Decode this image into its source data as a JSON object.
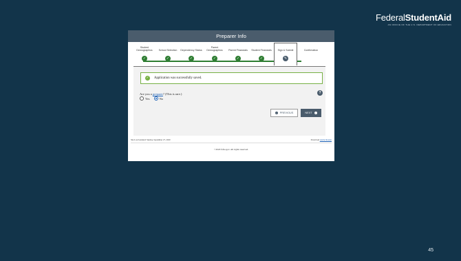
{
  "brand": {
    "name_regular": "Federal",
    "name_bold": "StudentAid",
    "subtitle": "An Office of the U.S. Department of Education"
  },
  "slide_number": "45",
  "window": {
    "title": "Preparer Info",
    "steps": [
      {
        "label": "Student Demographics",
        "status": "complete"
      },
      {
        "label": "School Selection",
        "status": "complete"
      },
      {
        "label": "Dependency Status",
        "status": "complete"
      },
      {
        "label": "Parent Demographics",
        "status": "complete"
      },
      {
        "label": "Parent Financials",
        "status": "complete"
      },
      {
        "label": "Student Financials",
        "status": "complete"
      },
      {
        "label": "Sign & Submit",
        "status": "active"
      },
      {
        "label": "Confirmation",
        "status": "pending"
      }
    ],
    "alert": "Application was successfully saved.",
    "question_prefix": "Are you a ",
    "question_link": "preparer",
    "question_suffix": "? (This is rare.)",
    "options": [
      {
        "label": "Yes",
        "selected": false
      },
      {
        "label": "No",
        "selected": true
      }
    ],
    "help_glyph": "?",
    "buttons": {
      "previous": "PREVIOUS",
      "next": "NEXT"
    },
    "footer": {
      "last_updated": "Site Last Updated: Sunday, September 27, 2020",
      "download_prefix": "Download ",
      "download_link": "Adobe Reader"
    },
    "copyright": "©2020 fafsa.gov. All rights reserved."
  },
  "colors": {
    "background": "#12344a",
    "header": "#4a5c6c",
    "success": "#2e7d32",
    "alert_border": "#76b043"
  }
}
